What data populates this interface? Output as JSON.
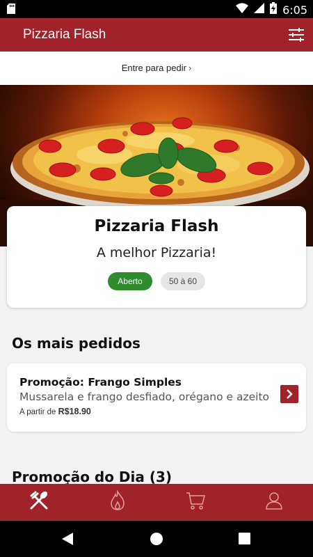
{
  "status_bar": {
    "time": "6:05",
    "icons": [
      "sd-card-icon",
      "wifi-icon",
      "signal-icon",
      "battery-charging-icon"
    ]
  },
  "app_bar": {
    "title": "Pizzaria Flash",
    "filter_icon": "filter-sliders-icon"
  },
  "login_bar": {
    "label": "Entre para pedir",
    "chevron": "›"
  },
  "hero": {
    "image": "pizza-photo"
  },
  "store": {
    "name": "Pizzaria Flash",
    "slogan": "A melhor Pizzaria!",
    "status_badge": "Aberto",
    "delivery_time": "50 à 60",
    "colors": {
      "primary": "#a1232a",
      "open_badge": "#2e8b2e"
    }
  },
  "sections": {
    "most_ordered": {
      "title": "Os mais pedidos",
      "products": [
        {
          "name": "Promoção: Frango Simples",
          "description": "Mussarela e frango desfiado, orégano e azeitona",
          "price_prefix": "A partir de",
          "price": "R$18.90"
        }
      ]
    },
    "daily_promo": {
      "title": "Promoção do Dia (3)"
    }
  },
  "bottom_nav": {
    "items": [
      {
        "icon": "fork-knife-icon",
        "active": true
      },
      {
        "icon": "flame-icon",
        "active": false
      },
      {
        "icon": "cart-icon",
        "active": false
      },
      {
        "icon": "user-icon",
        "active": false
      }
    ]
  },
  "android_nav": {
    "buttons": [
      "back-icon",
      "home-icon",
      "recents-icon"
    ]
  }
}
